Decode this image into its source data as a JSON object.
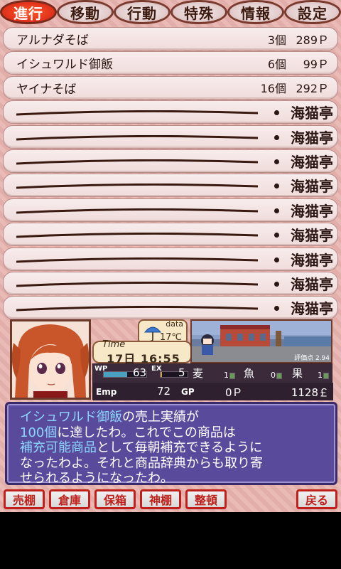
{
  "tabs": [
    {
      "label": "進行",
      "active": true
    },
    {
      "label": "移動",
      "active": false
    },
    {
      "label": "行動",
      "active": false
    },
    {
      "label": "特殊",
      "active": false
    },
    {
      "label": "情報",
      "active": false
    },
    {
      "label": "設定",
      "active": false
    }
  ],
  "shelf": {
    "items": [
      {
        "name": "アルナダそば",
        "qty": "3個",
        "price": "289Ｐ"
      },
      {
        "name": "イシュワルド御飯",
        "qty": "6個",
        "price": "99Ｐ"
      },
      {
        "name": "ヤイナそば",
        "qty": "16個",
        "price": "292Ｐ"
      }
    ],
    "empty_slots": [
      {
        "shop": "海猫亭"
      },
      {
        "shop": "海猫亭"
      },
      {
        "shop": "海猫亭"
      },
      {
        "shop": "海猫亭"
      },
      {
        "shop": "海猫亭"
      },
      {
        "shop": "海猫亭"
      },
      {
        "shop": "海猫亭"
      },
      {
        "shop": "海猫亭"
      },
      {
        "shop": "海猫亭"
      }
    ]
  },
  "status": {
    "weather_label": "data",
    "weather_icon": "umbrella-icon",
    "temperature": "17℃",
    "time_label": "Time",
    "time_value": "17日 16:55",
    "score": "評価点 2.94",
    "wp_label": "WP",
    "wp_value": "63",
    "wp_level": 0.55,
    "ex_label": "EX",
    "ex_value": "5",
    "ex_level": 0.05,
    "ingredients": [
      {
        "kanji": "麦",
        "count": "1"
      },
      {
        "kanji": "魚",
        "count": "0"
      },
      {
        "kanji": "果",
        "count": "1"
      }
    ],
    "emp_label": "Emp",
    "emp_value": "72",
    "gp_label": "GP",
    "gp_value": "0Ｐ",
    "money": "1128￡"
  },
  "message": {
    "p1": "イシュワルド御飯",
    "p2": "の売上実績が",
    "p3": "100個",
    "p4": "に達したわ。これでこの商品は",
    "p5": "補充可能商品",
    "p6": "として毎朝補充できるように",
    "p7": "なったわよ。それと商品辞典からも取り寄",
    "p8": "せられるようになったわ。"
  },
  "buttons": {
    "sell": "売棚",
    "storage": "倉庫",
    "box": "保箱",
    "shrine": "神棚",
    "arrange": "整頓",
    "back": "戻る"
  },
  "colors": {
    "background": "#e8b4b0",
    "tab_active": "#e0301a",
    "message_bg": "#5a4a9c",
    "highlight": "#8ad8ff",
    "button_border": "#c0201a"
  }
}
